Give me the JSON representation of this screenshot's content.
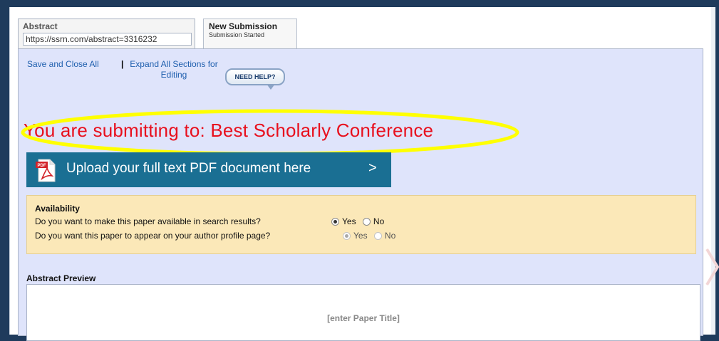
{
  "tabs": {
    "abstract": {
      "title": "Abstract",
      "url": "https://ssrn.com/abstract=3316232"
    },
    "new_submission": {
      "title": "New Submission",
      "subtitle": "Submission Started"
    }
  },
  "actions": {
    "save_close": "Save and Close All",
    "separator": "|",
    "expand_all": "Expand All Sections for Editing",
    "need_help": "NEED HELP?"
  },
  "submission": {
    "target_text": "You are submitting to: Best Scholarly Conference",
    "highlight_color": "#ffff00"
  },
  "upload": {
    "label": "Upload your full text PDF document here",
    "chevron": ">",
    "icon": "pdf-file-icon",
    "icon_text": "PDF",
    "bar_color": "#1a6f93"
  },
  "availability": {
    "title": "Availability",
    "questions": [
      {
        "text": "Do you want to make this paper available in search results?",
        "options": [
          {
            "label": "Yes",
            "checked": true,
            "disabled": false
          },
          {
            "label": "No",
            "checked": false,
            "disabled": false
          }
        ]
      },
      {
        "text": "Do you want this paper to appear on your author profile page?",
        "options": [
          {
            "label": "Yes",
            "checked": true,
            "disabled": true
          },
          {
            "label": "No",
            "checked": false,
            "disabled": true
          }
        ]
      }
    ]
  },
  "abstract_preview": {
    "title": "Abstract Preview",
    "paper_title_placeholder": "[enter Paper Title]"
  }
}
